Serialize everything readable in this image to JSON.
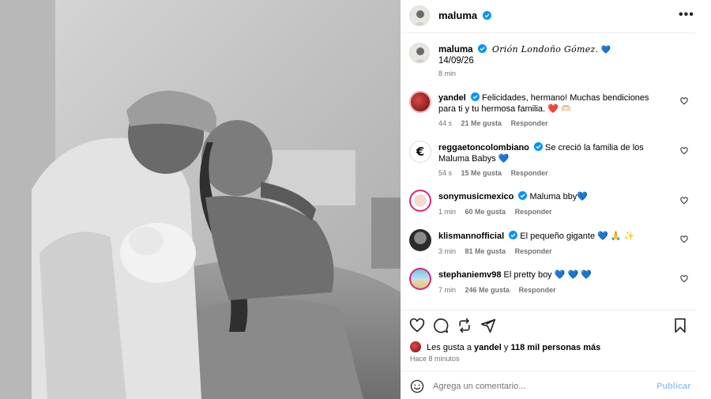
{
  "post": {
    "author": "maluma",
    "more_glyph": "•••",
    "caption_author": "maluma",
    "caption_text": "Orión Londoño Gómez.",
    "caption_heart": "💙",
    "caption_date": "14/09/26",
    "caption_time": "8 min"
  },
  "comments": [
    {
      "user": "yandel",
      "verified": true,
      "text": "Felicidades, hermano! Muchas bendiciones para ti y tu hermosa familia. ❤️ 🫶🏻",
      "time": "44 s",
      "likes": "21 Me gusta",
      "reply": "Responder"
    },
    {
      "user": "reggaetoncolombiano",
      "verified": true,
      "text": "Se creció la familia de los Maluma Babys 💙",
      "time": "54 s",
      "likes": "15 Me gusta",
      "reply": "Responder"
    },
    {
      "user": "sonymusicmexico",
      "verified": true,
      "text": "Maluma bby💙",
      "time": "1 min",
      "likes": "60 Me gusta",
      "reply": "Responder"
    },
    {
      "user": "klismannofficial",
      "verified": true,
      "text": "El pequeño gigante 💙 🙏 ✨",
      "time": "3 min",
      "likes": "81 Me gusta",
      "reply": "Responder"
    },
    {
      "user": "stephaniemv98",
      "verified": false,
      "text": "El pretty boy 💙 💙 💙",
      "time": "7 min",
      "likes": "246 Me gusta",
      "reply": "Responder"
    }
  ],
  "likes": {
    "prefix": "Les gusta a",
    "user": "yandel",
    "connector": "y",
    "count": "118 mil personas más"
  },
  "ago": "Hace 8 minutos",
  "composer": {
    "placeholder": "Agrega un comentario...",
    "publish": "Publicar"
  },
  "colors": {
    "verified": "#0095f6",
    "publish": "#9ac7f3",
    "muted": "#737373"
  }
}
